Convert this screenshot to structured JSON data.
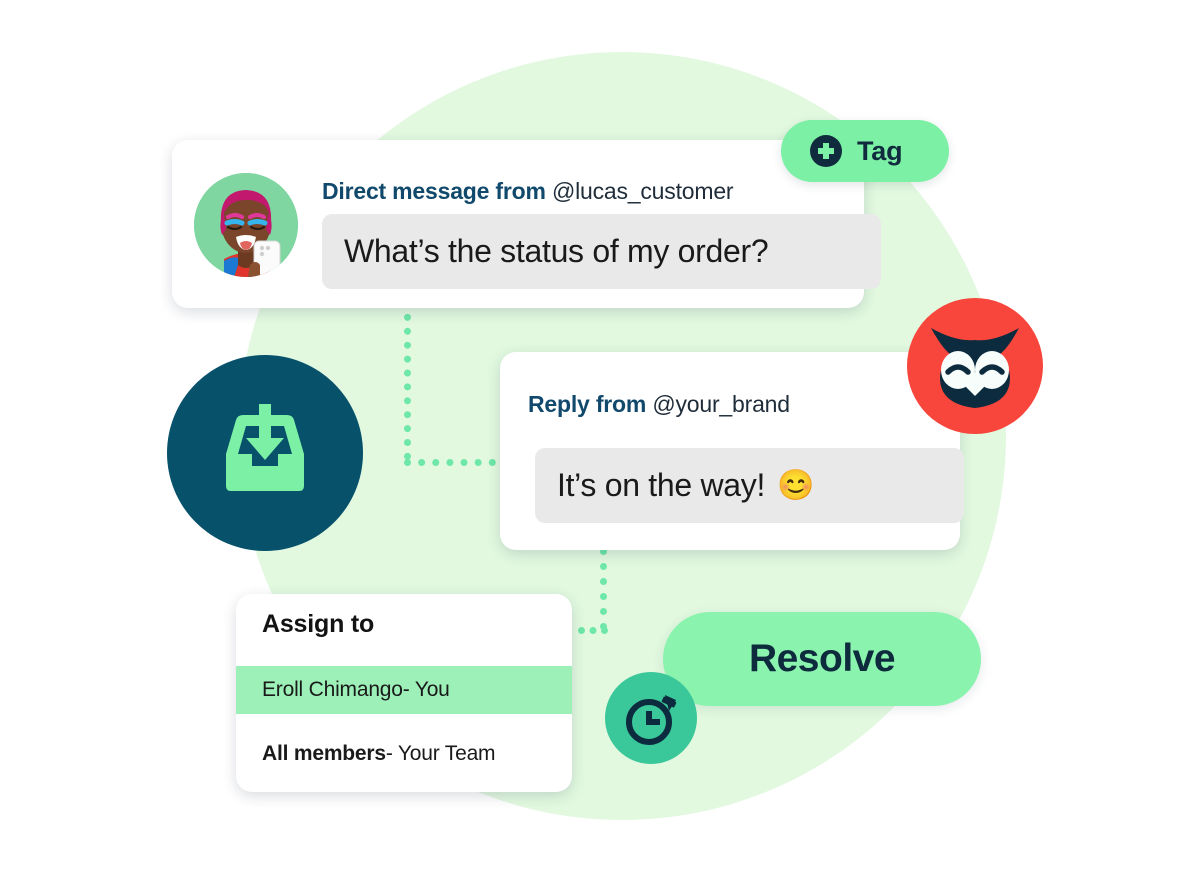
{
  "theme": {
    "bg_circle": "#e2f9e0",
    "accent_green": "#7cf0a4",
    "accent_mint": "#8af3ad",
    "row_highlight": "#9cf0b8",
    "dark_navy": "#102b3e",
    "head_blue": "#11496c",
    "inbox_circle": "#07516b",
    "owl_red": "#f8463c",
    "clock_teal": "#3ac79a",
    "dotted_line": "#6ee7a8",
    "bubble_grey": "#e9e9e9"
  },
  "tag_button": {
    "label": "Tag",
    "icon": "plus-circle-icon"
  },
  "direct_message_card": {
    "avatar_alt": "customer-avatar",
    "header_strong": "Direct message from",
    "header_handle": "@lucas_customer",
    "message": "What’s the status of my order?"
  },
  "reply_card": {
    "header_strong": "Reply from",
    "header_handle": "@your_brand",
    "message": "It’s on the way!",
    "emoji": "😊"
  },
  "assign_card": {
    "title": "Assign to",
    "rows": [
      {
        "name": "Eroll Chimango",
        "suffix": " - You",
        "selected": true
      },
      {
        "name": "All members",
        "suffix": " - Your Team",
        "selected": false
      }
    ]
  },
  "resolve_button": {
    "label": "Resolve"
  },
  "badges": {
    "inbox": "inbox-download-icon",
    "owl": "hootsuite-owl-icon",
    "clock": "stopwatch-icon"
  }
}
